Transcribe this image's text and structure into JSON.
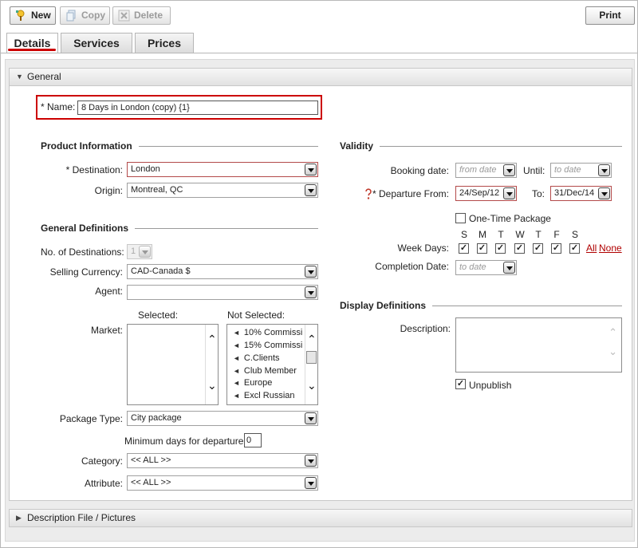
{
  "toolbar": {
    "new_label": "New",
    "copy_label": "Copy",
    "delete_label": "Delete",
    "print_label": "Print"
  },
  "tabs": [
    {
      "label": "Details",
      "active": true
    },
    {
      "label": "Services",
      "active": false
    },
    {
      "label": "Prices",
      "active": false
    }
  ],
  "panels": {
    "general": "General",
    "description_file": "Description File / Pictures"
  },
  "name": {
    "label": "* Name:",
    "value": "8  Days in London   (copy) {1}"
  },
  "product_info": {
    "title": "Product Information",
    "destination_label": "* Destination:",
    "destination_value": "London",
    "origin_label": "Origin:",
    "origin_value": "Montreal, QC"
  },
  "general_definitions": {
    "title": "General Definitions",
    "num_destinations_label": "No. of Destinations:",
    "num_destinations_value": "1",
    "selling_currency_label": "Selling Currency:",
    "selling_currency_value": "CAD-Canada $",
    "agent_label": "Agent:",
    "agent_value": "",
    "market_label": "Market:",
    "selected_label": "Selected:",
    "not_selected_label": "Not Selected:",
    "not_selected_items": [
      "10% Commissi",
      "15% Commissi",
      "C.Clients",
      "Club Member",
      "Europe",
      "Excl Russian"
    ],
    "package_type_label": "Package Type:",
    "package_type_value": "City package",
    "min_days_label": "Minimum days for departure",
    "min_days_value": "0",
    "category_label": "Category:",
    "category_value": "<< ALL >>",
    "attribute_label": "Attribute:",
    "attribute_value": "<< ALL >>"
  },
  "validity": {
    "title": "Validity",
    "booking_date_label": "Booking date:",
    "booking_from_placeholder": "from date",
    "until_label": "Until:",
    "booking_to_placeholder": "to date",
    "departure_from_label": "* Departure From:",
    "departure_from_value": "24/Sep/12",
    "to_label": "To:",
    "departure_to_value": "31/Dec/14",
    "one_time_label": "One-Time Package",
    "one_time_checked": false,
    "week_days_label": "Week Days:",
    "days": [
      "S",
      "M",
      "T",
      "W",
      "T",
      "F",
      "S"
    ],
    "all_link": "All",
    "none_link": "None",
    "completion_label": "Completion Date:",
    "completion_placeholder": "to date"
  },
  "display_definitions": {
    "title": "Display Definitions",
    "description_label": "Description:",
    "description_value": "",
    "unpublish_label": "Unpublish",
    "unpublish_checked": true
  },
  "colors": {
    "accent_red": "#cc0000",
    "link_red": "#b00000"
  }
}
